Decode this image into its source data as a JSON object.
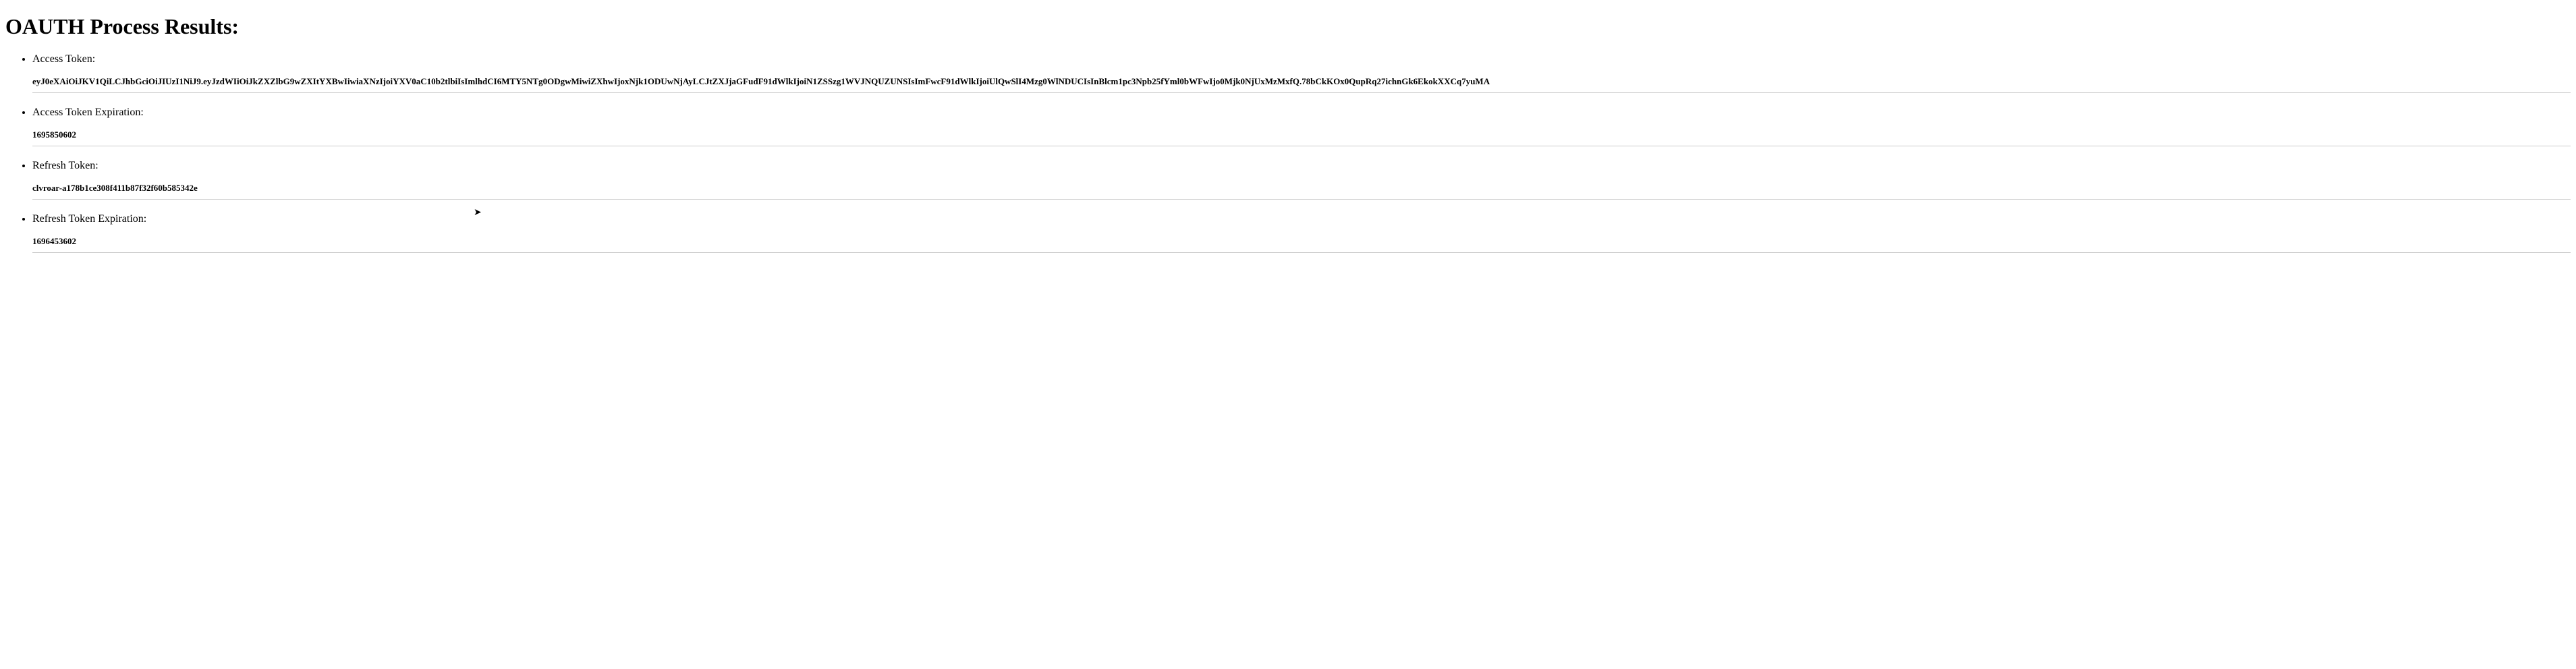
{
  "heading": "OAUTH Process Results:",
  "items": [
    {
      "label": "Access Token:",
      "value": "eyJ0eXAiOiJKV1QiLCJhbGciOiJIUzI1NiJ9.eyJzdWIiOiJkZXZlbG9wZXItYXBwIiwiaXNzIjoiYXV0aC10b2tlbiIsImlhdCI6MTY5NTg0ODgwMiwiZXhwIjoxNjk1ODUwNjAyLCJtZXJjaGFudF91dWlkIjoiN1ZSSzg1WVJNQUZUNSIsImFwcF91dWlkIjoiUlQwSlI4Mzg0WlNDUCIsInBlcm1pc3Npb25fYml0bWFwIjo0Mjk0NjUxMzMxfQ.78bCkKOx0QupRq27ichnGk6EkokXXCq7yuMA"
    },
    {
      "label": "Access Token Expiration:",
      "value": "1695850602"
    },
    {
      "label": "Refresh Token:",
      "value": "clvroar-a178b1ce308f411b87f32f60b585342e"
    },
    {
      "label": "Refresh Token Expiration:",
      "value": "1696453602"
    }
  ]
}
